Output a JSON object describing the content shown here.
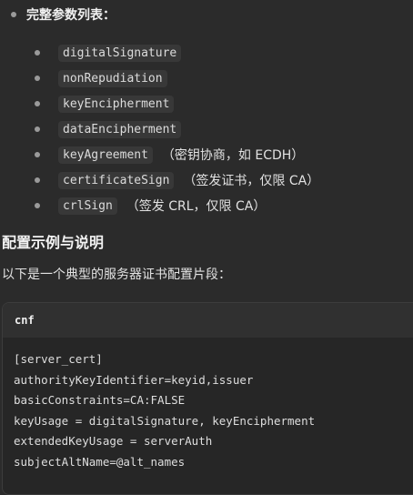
{
  "params": {
    "title": "完整参数列表：",
    "items": [
      {
        "code": "digitalSignature",
        "note": ""
      },
      {
        "code": "nonRepudiation",
        "note": ""
      },
      {
        "code": "keyEncipherment",
        "note": ""
      },
      {
        "code": "dataEncipherment",
        "note": ""
      },
      {
        "code": "keyAgreement",
        "note": "（密钥协商，如 ECDH）"
      },
      {
        "code": "certificateSign",
        "note": "（签发证书，仅限 CA）"
      },
      {
        "code": "crlSign",
        "note": "（签发 CRL，仅限 CA）"
      }
    ]
  },
  "section": {
    "heading": "配置示例与说明",
    "intro": "以下是一个典型的服务器证书配置片段："
  },
  "codeblock": {
    "language": "cnf",
    "lines": [
      "[server_cert]",
      "authorityKeyIdentifier=keyid,issuer",
      "basicConstraints=CA:FALSE",
      "keyUsage = digitalSignature, keyEncipherment",
      "extendedKeyUsage = serverAuth",
      "subjectAltName=@alt_names"
    ]
  }
}
